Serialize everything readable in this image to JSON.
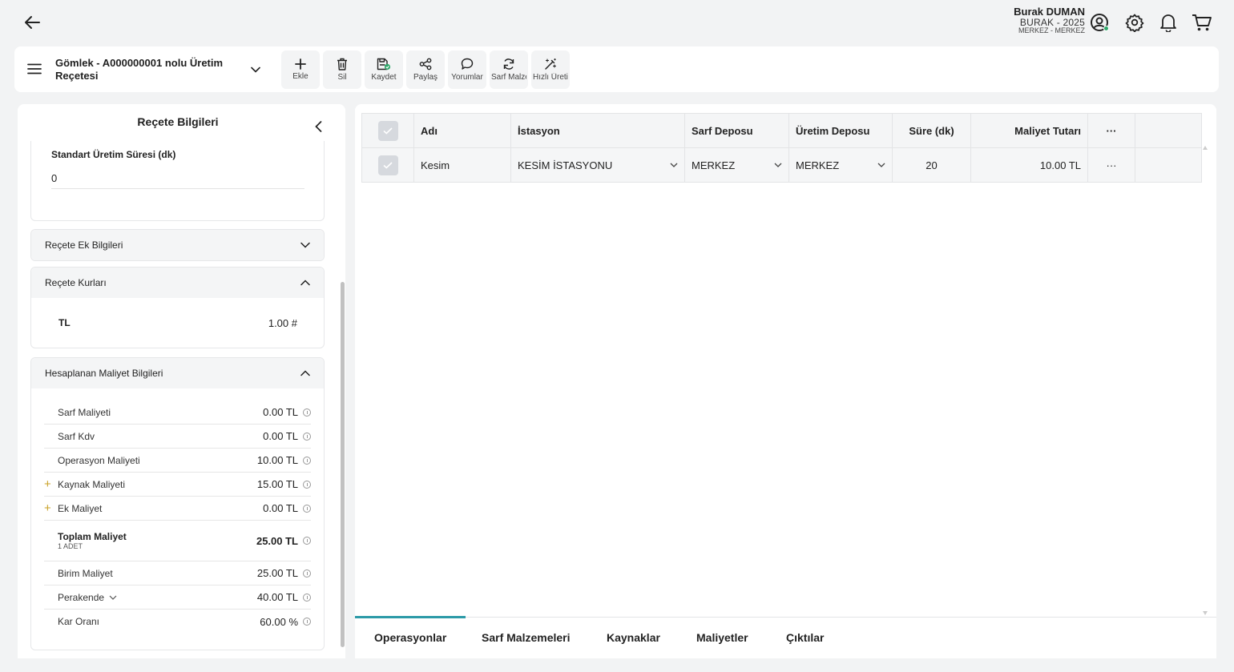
{
  "user": {
    "name": "Burak DUMAN",
    "company": "BURAK - 2025",
    "branch": "MERKEZ - MERKEZ"
  },
  "toolbar": {
    "title": "Gömlek - A000000001 nolu Üretim Reçetesi",
    "buttons": [
      {
        "label": "Ekle",
        "icon": "plus-icon"
      },
      {
        "label": "Sil",
        "icon": "trash-icon"
      },
      {
        "label": "Kaydet",
        "icon": "save-icon"
      },
      {
        "label": "Paylaş",
        "icon": "share-icon"
      },
      {
        "label": "Yorumlar",
        "icon": "comment-icon"
      },
      {
        "label": "Sarf Malzemeleri",
        "icon": "refresh-icon"
      },
      {
        "label": "Hızlı Üretim",
        "icon": "magic-wand-icon"
      }
    ]
  },
  "left_panel": {
    "title": "Reçete Bilgileri",
    "std_time": {
      "label": "Standart Üretim Süresi (dk)",
      "value": "0"
    },
    "sections": {
      "extra_info": "Reçete Ek Bilgileri",
      "rates": "Reçete Kurları",
      "calculated": "Hesaplanan Maliyet Bilgileri"
    },
    "rates": [
      {
        "code": "TL",
        "value": "1.00 #"
      }
    ],
    "costs": [
      {
        "name": "Sarf Maliyeti",
        "value": "0.00 TL",
        "plus": false
      },
      {
        "name": "Sarf Kdv",
        "value": "0.00 TL",
        "plus": false
      },
      {
        "name": "Operasyon Maliyeti",
        "value": "10.00 TL",
        "plus": false
      },
      {
        "name": "Kaynak Maliyeti",
        "value": "15.00 TL",
        "plus": true
      },
      {
        "name": "Ek Maliyet",
        "value": "0.00 TL",
        "plus": true
      }
    ],
    "total": {
      "name": "Toplam Maliyet",
      "unit": "1 ADET",
      "value": "25.00 TL"
    },
    "unit_cost": {
      "name": "Birim Maliyet",
      "value": "25.00 TL"
    },
    "retail": {
      "name": "Perakende",
      "value": "40.00 TL"
    },
    "margin": {
      "name": "Kar Oranı",
      "value": "60.00 %"
    }
  },
  "grid": {
    "columns": [
      "Adı",
      "İstasyon",
      "Sarf Deposu",
      "Üretim Deposu",
      "Süre (dk)",
      "Maliyet Tutarı",
      "···"
    ],
    "rows": [
      {
        "name": "Kesim",
        "station": "KESİM İSTASYONU",
        "consumption_depot": "MERKEZ",
        "production_depot": "MERKEZ",
        "duration": "20",
        "cost": "10.00 TL",
        "more": "···"
      }
    ]
  },
  "tabs": [
    "Operasyonlar",
    "Sarf Malzemeleri",
    "Kaynaklar",
    "Maliyetler",
    "Çıktılar"
  ],
  "active_tab": "Operasyonlar",
  "colors": {
    "accent": "#2c9aa8",
    "status_online": "#2ea86a",
    "plus_marker": "#c9a227"
  }
}
